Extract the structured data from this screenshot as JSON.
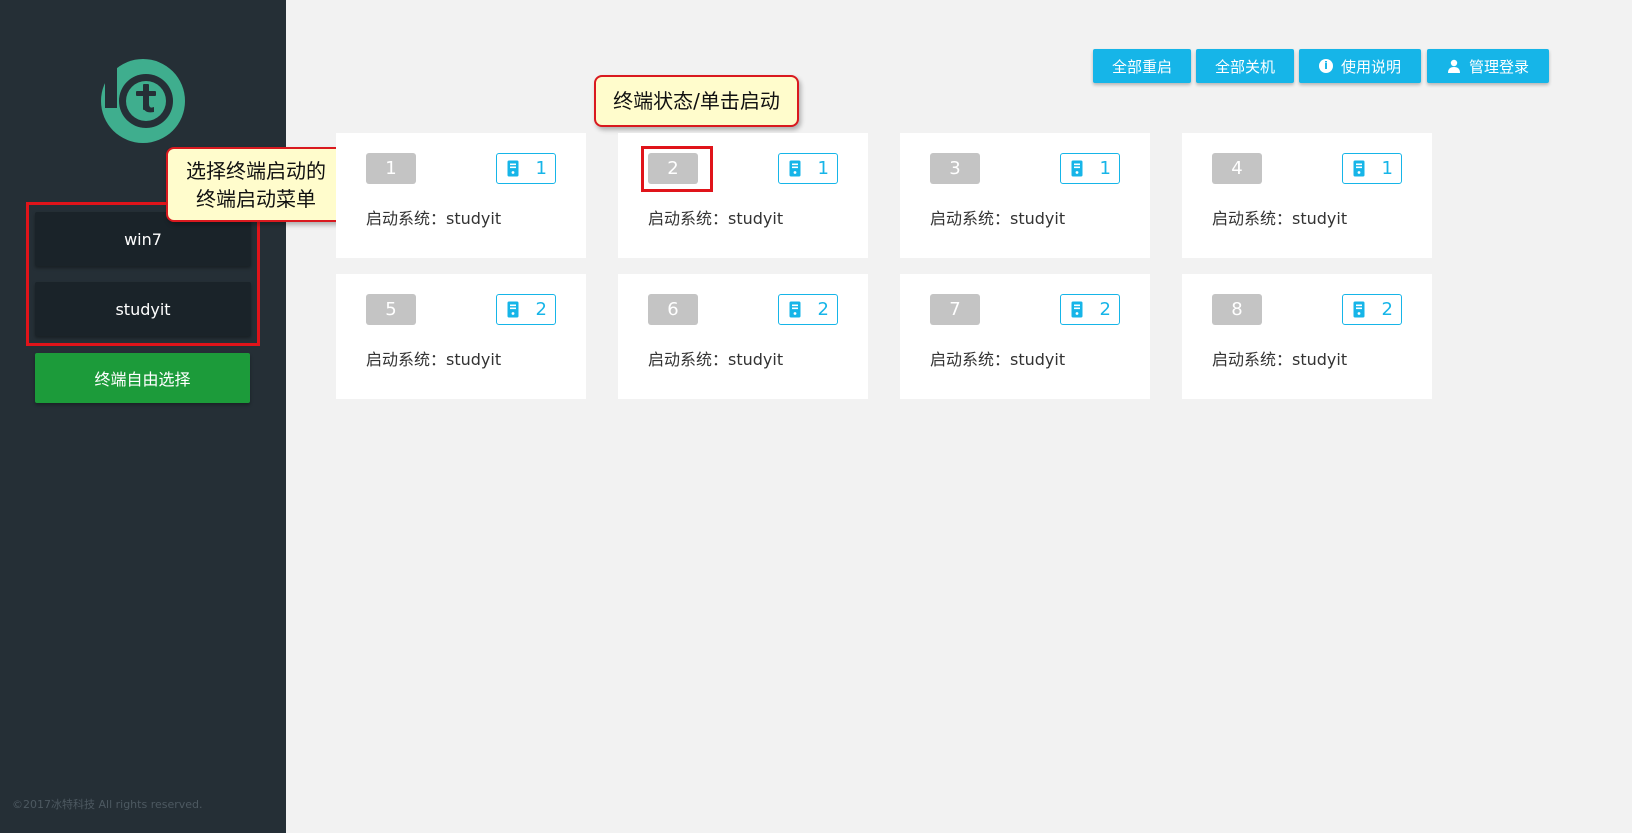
{
  "sidebar": {
    "menu_items": [
      "win7",
      "studyit"
    ],
    "free_select_label": "终端自由选择",
    "copyright": "©2017冰特科技 All rights reserved."
  },
  "callouts": {
    "menu": "选择终端启动的\n终端启动菜单",
    "status": "终端状态/单击启动"
  },
  "top_buttons": {
    "restart_all": "全部重启",
    "shutdown_all": "全部关机",
    "manual": "使用说明",
    "admin_login": "管理登录"
  },
  "colors": {
    "accent": "#16b5e8",
    "sidebar_bg": "#252f36",
    "green": "#1c9b3a",
    "highlight": "#e0141a"
  },
  "terminals": [
    {
      "num": "1",
      "count": "1",
      "system_label": "启动系统：",
      "system": "studyit"
    },
    {
      "num": "2",
      "count": "1",
      "system_label": "启动系统：",
      "system": "studyit"
    },
    {
      "num": "3",
      "count": "1",
      "system_label": "启动系统：",
      "system": "studyit"
    },
    {
      "num": "4",
      "count": "1",
      "system_label": "启动系统：",
      "system": "studyit"
    },
    {
      "num": "5",
      "count": "2",
      "system_label": "启动系统：",
      "system": "studyit"
    },
    {
      "num": "6",
      "count": "2",
      "system_label": "启动系统：",
      "system": "studyit"
    },
    {
      "num": "7",
      "count": "2",
      "system_label": "启动系统：",
      "system": "studyit"
    },
    {
      "num": "8",
      "count": "2",
      "system_label": "启动系统：",
      "system": "studyit"
    }
  ]
}
